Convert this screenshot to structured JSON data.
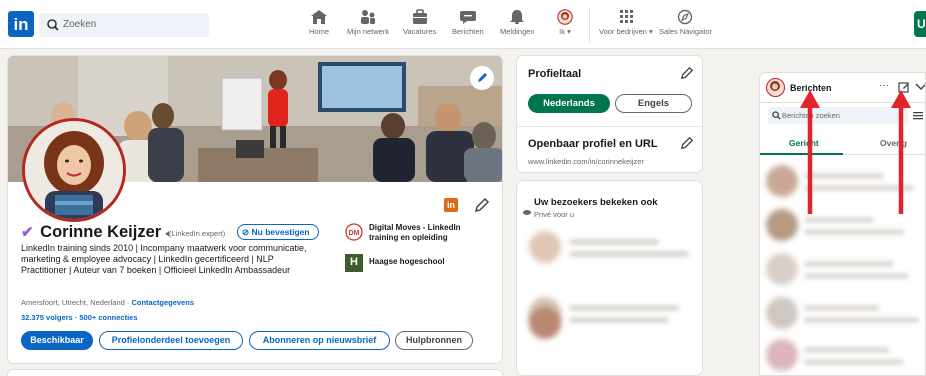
{
  "topnav": {
    "search_placeholder": "Zoeken",
    "items": [
      {
        "label": "Home",
        "icon": "home-icon"
      },
      {
        "label": "Mijn netwerk",
        "icon": "network-icon"
      },
      {
        "label": "Vacatures",
        "icon": "briefcase-icon"
      },
      {
        "label": "Berichten",
        "icon": "messaging-icon"
      },
      {
        "label": "Meldingen",
        "icon": "bell-icon"
      },
      {
        "label": "Ik ▾",
        "icon": "avatar"
      },
      {
        "label": "Voor bedrijven ▾",
        "icon": "grid-icon"
      },
      {
        "label": "Sales Navigator",
        "icon": "compass-icon"
      }
    ],
    "logo_text": "in",
    "right_badge": "U"
  },
  "profile": {
    "name": "Corinne Keijzer",
    "expert_label": "(LinkedIn expert)",
    "verify_label": "Nu bevestigen",
    "headline": "LinkedIn training sinds 2010 | Incompany maatwerk voor communicatie, marketing & employee advocacy | LinkedIn gecertificeerd | NLP Practitioner | Auteur van 7 boeken | Officieel LinkedIn Ambassadeur",
    "location": "Amersfoort, Utrecht, Nederland",
    "contact_link": "Contactgegevens",
    "followers": "32.375 volgers · 500+ connecties",
    "company_1": "Digital Moves - LinkedIn training en opleiding",
    "company_2": "Haagse hogeschool",
    "company_2_logo_letter": "H",
    "in_badge": "in",
    "buttons": {
      "available": "Beschikbaar",
      "add_section": "Profielonderdeel toevoegen",
      "newsletter": "Abonneren op nieuwsbrief",
      "resources": "Hulpbronnen"
    }
  },
  "language_card": {
    "title": "Profieltaal",
    "lang_active": "Nederlands",
    "lang_other": "Engels",
    "public_title": "Openbaar profiel en URL",
    "public_url": "www.linkedin.com/in/corinnekeijzer"
  },
  "visitors_card": {
    "title": "Uw bezoekers bekeken ook",
    "privacy": "Privé voor u"
  },
  "messages": {
    "title": "Berichten",
    "more": "···",
    "search_placeholder": "Berichten zoeken",
    "tab_focused": "Gericht",
    "tab_other": "Overig"
  },
  "colors": {
    "brand": "#0a66c2",
    "green": "#01754f",
    "arrow": "#e0242d"
  }
}
